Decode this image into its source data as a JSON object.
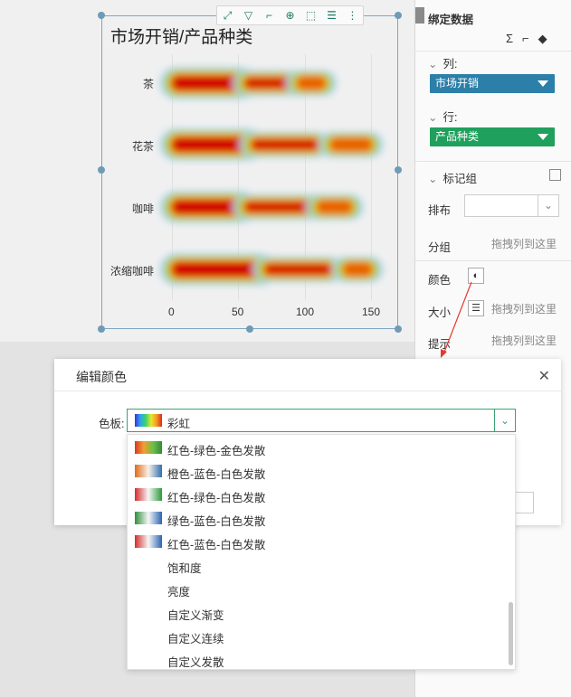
{
  "chart": {
    "title": "市场开销/产品种类",
    "toolbar_icons": [
      "expand-icon",
      "filter-icon",
      "crop-icon",
      "zoom-in-icon",
      "select-icon",
      "list-icon",
      "more-icon"
    ]
  },
  "chart_data": {
    "type": "heatmap",
    "title": "市场开销/产品种类",
    "categories": [
      "茶",
      "花茶",
      "咖啡",
      "浓缩咖啡"
    ],
    "x_ticks": [
      "0",
      "50",
      "100",
      "150"
    ],
    "xlim": [
      0,
      160
    ],
    "series": [
      {
        "category": "茶",
        "spans": [
          [
            0,
            55
          ],
          [
            55,
            95
          ],
          [
            95,
            115
          ]
        ]
      },
      {
        "category": "花茶",
        "spans": [
          [
            0,
            60
          ],
          [
            60,
            110
          ],
          [
            120,
            150
          ]
        ]
      },
      {
        "category": "咖啡",
        "spans": [
          [
            0,
            55
          ],
          [
            55,
            110
          ],
          [
            110,
            135
          ]
        ]
      },
      {
        "category": "浓缩咖啡",
        "spans": [
          [
            0,
            70
          ],
          [
            70,
            120
          ],
          [
            130,
            150
          ]
        ]
      }
    ],
    "colors": [
      "#d10000",
      "#e86000",
      "#f4c200",
      "#7ad34a",
      "#b8d4ef"
    ]
  },
  "sidebar": {
    "title": "绑定数据",
    "column_label": "列:",
    "column_value": "市场开销",
    "row_label": "行:",
    "row_value": "产品种类",
    "marks_label": "标记组",
    "layout_label": "排布",
    "group_label": "分组",
    "group_hint": "拖拽列到这里",
    "color_label": "颜色",
    "size_label": "大小",
    "size_hint": "拖拽列到这里",
    "tooltip_label": "提示",
    "tooltip_hint": "拖拽列到这里",
    "col_pill_color": "#2b7fa8",
    "row_pill_color": "#1fa05c"
  },
  "dialog": {
    "title": "编辑颜色",
    "palette_label": "色板:",
    "selected": "彩虹",
    "options": [
      {
        "label": "红色-绿色-金色发散",
        "swatch": "linear-gradient(90deg,#d9362a,#f0a030,#6fbf4a,#2e8b3a)"
      },
      {
        "label": "橙色-蓝色-白色发散",
        "swatch": "linear-gradient(90deg,#e06a1b,#f8f0e8,#2f6fb0)"
      },
      {
        "label": "红色-绿色-白色发散",
        "swatch": "linear-gradient(90deg,#d42b2b,#f6f6f6,#2a9a3a)"
      },
      {
        "label": "绿色-蓝色-白色发散",
        "swatch": "linear-gradient(90deg,#2f8f3a,#f6f6f6,#2a65b0)"
      },
      {
        "label": "红色-蓝色-白色发散",
        "swatch": "linear-gradient(90deg,#d42b2b,#f6f6f6,#2a65b0)"
      },
      {
        "label": "饱和度",
        "swatch": ""
      },
      {
        "label": "亮度",
        "swatch": ""
      },
      {
        "label": "自定义渐变",
        "swatch": ""
      },
      {
        "label": "自定义连续",
        "swatch": ""
      },
      {
        "label": "自定义发散",
        "swatch": ""
      }
    ]
  }
}
